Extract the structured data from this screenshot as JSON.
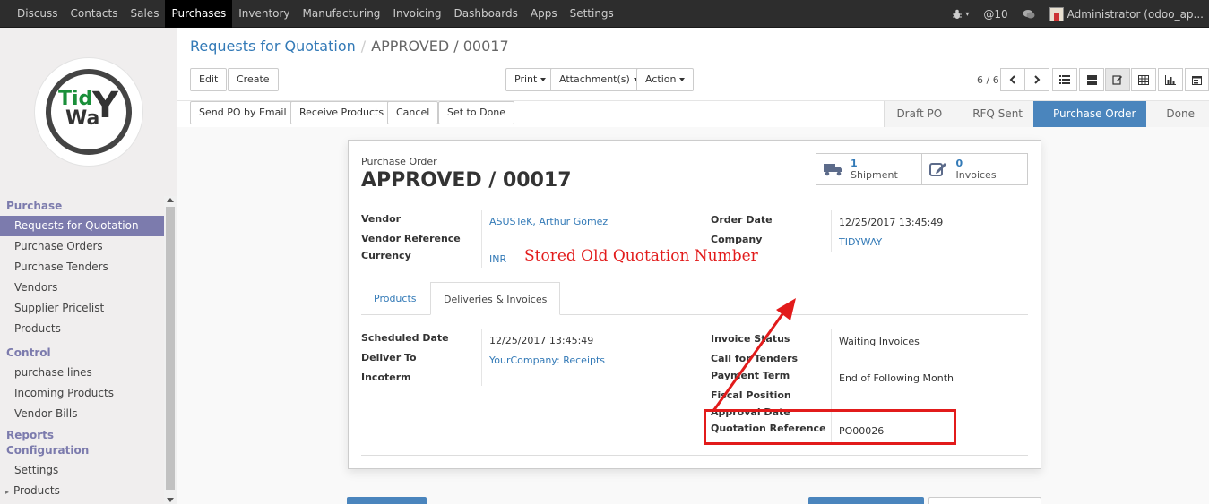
{
  "topnav": {
    "menu": [
      "Discuss",
      "Contacts",
      "Sales",
      "Purchases",
      "Inventory",
      "Manufacturing",
      "Invoicing",
      "Dashboards",
      "Apps",
      "Settings"
    ],
    "active": "Purchases",
    "mentions": "@10",
    "user": "Administrator (odoo_ap..."
  },
  "sidebar": {
    "logo_text_top": "Tid",
    "logo_text_bottom": "Wa",
    "logo_text_big": "Y",
    "sections": [
      {
        "header": "Purchase",
        "items": [
          "Requests for Quotation",
          "Purchase Orders",
          "Purchase Tenders",
          "Vendors",
          "Supplier Pricelist",
          "Products"
        ]
      },
      {
        "header": "Control",
        "items": [
          "purchase lines",
          "Incoming Products",
          "Vendor Bills"
        ]
      },
      {
        "header": "Reports",
        "items": []
      },
      {
        "header": "Configuration",
        "items": [
          "Settings",
          "Products"
        ]
      }
    ],
    "active_item": "Requests for Quotation"
  },
  "breadcrumb": {
    "parent": "Requests for Quotation",
    "current": "APPROVED / 00017"
  },
  "toolbar": {
    "edit": "Edit",
    "create": "Create",
    "print": "Print",
    "attachments": "Attachment(s)",
    "action": "Action",
    "pager": "6 / 6"
  },
  "statusbar": {
    "buttons": [
      "Send PO by Email",
      "Receive Products",
      "Cancel",
      "Set to Done"
    ],
    "stages": [
      "Draft PO",
      "RFQ Sent",
      "Purchase Order",
      "Done"
    ],
    "active_stage": "Purchase Order"
  },
  "sheet": {
    "subtitle": "Purchase Order",
    "title": "APPROVED / 00017",
    "smart_buttons": [
      {
        "count": "1",
        "label": "Shipment",
        "icon": "truck-icon"
      },
      {
        "count": "0",
        "label": "Invoices",
        "icon": "edit-icon"
      }
    ],
    "left_fields": [
      {
        "label": "Vendor",
        "value": "ASUSTeK, Arthur Gomez",
        "link": true
      },
      {
        "label": "Vendor Reference",
        "value": "",
        "link": false
      },
      {
        "label": "Currency",
        "value": "INR",
        "link": true
      }
    ],
    "right_fields": [
      {
        "label": "Order Date",
        "value": "12/25/2017 13:45:49",
        "link": false
      },
      {
        "label": "Company",
        "value": "TIDYWAY",
        "link": true
      }
    ],
    "tabs": [
      "Products",
      "Deliveries & Invoices"
    ],
    "active_tab": "Deliveries & Invoices",
    "tab_left_fields": [
      {
        "label": "Scheduled Date",
        "value": "12/25/2017 13:45:49",
        "link": false
      },
      {
        "label": "Deliver To",
        "value": "YourCompany: Receipts",
        "link": true
      },
      {
        "label": "Incoterm",
        "value": "",
        "link": false
      }
    ],
    "tab_right_fields": [
      {
        "label": "Invoice Status",
        "value": "Waiting Invoices"
      },
      {
        "label": "Call for Tenders",
        "value": ""
      },
      {
        "label": "Payment Term",
        "value": "End of Following Month"
      },
      {
        "label": "Fiscal Position",
        "value": ""
      },
      {
        "label": "Approval Date",
        "value": ""
      },
      {
        "label": "Quotation Reference",
        "value": "PO00026"
      }
    ]
  },
  "annotation": {
    "text": "Stored Old Quotation Number",
    "color": "#e21b1b"
  },
  "colors": {
    "accent": "#7c7bad",
    "link": "#337ab7",
    "stage_active": "#4a85bd"
  }
}
